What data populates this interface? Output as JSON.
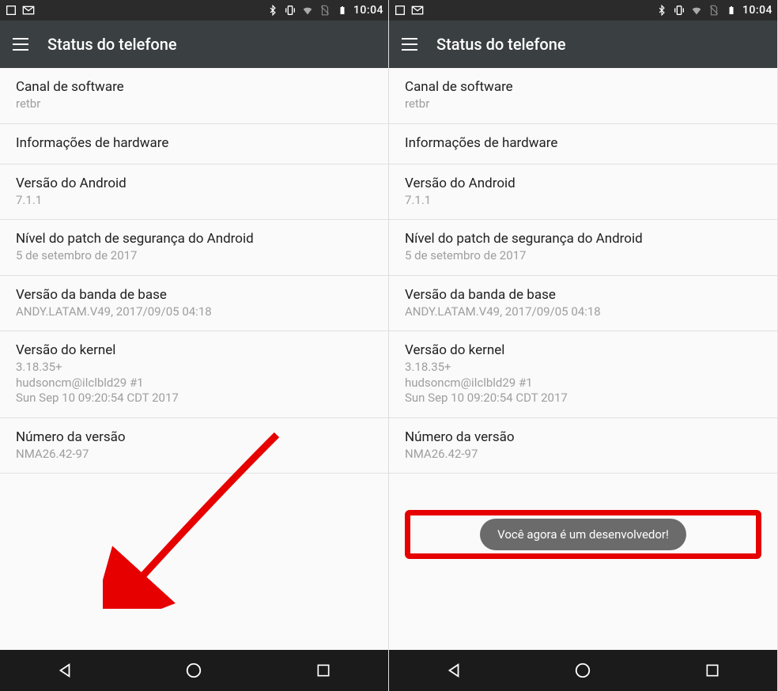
{
  "statusbar": {
    "time": "10:04"
  },
  "appbar": {
    "title": "Status do telefone"
  },
  "left": {
    "items": [
      {
        "title": "Canal de software",
        "sub": "retbr"
      },
      {
        "title": "Informações de hardware",
        "sub": ""
      },
      {
        "title": "Versão do Android",
        "sub": "7.1.1"
      },
      {
        "title": "Nível do patch de segurança do Android",
        "sub": "5 de setembro de 2017"
      },
      {
        "title": "Versão da banda de base",
        "sub": "ANDY.LATAM.V49, 2017/09/05 04:18"
      },
      {
        "title": "Versão do kernel",
        "sub": "3.18.35+\nhudsoncm@ilclbld29 #1\nSun Sep 10 09:20:54 CDT 2017"
      },
      {
        "title": "Número da versão",
        "sub": "NMA26.42-97"
      }
    ]
  },
  "right": {
    "items": [
      {
        "title": "Canal de software",
        "sub": "retbr"
      },
      {
        "title": "Informações de hardware",
        "sub": ""
      },
      {
        "title": "Versão do Android",
        "sub": "7.1.1"
      },
      {
        "title": "Nível do patch de segurança do Android",
        "sub": "5 de setembro de 2017"
      },
      {
        "title": "Versão da banda de base",
        "sub": "ANDY.LATAM.V49, 2017/09/05 04:18"
      },
      {
        "title": "Versão do kernel",
        "sub": "3.18.35+\nhudsoncm@ilclbld29 #1\nSun Sep 10 09:20:54 CDT 2017"
      },
      {
        "title": "Número da versão",
        "sub": "NMA26.42-97"
      }
    ],
    "toast": "Você agora é um desenvolvedor!"
  }
}
